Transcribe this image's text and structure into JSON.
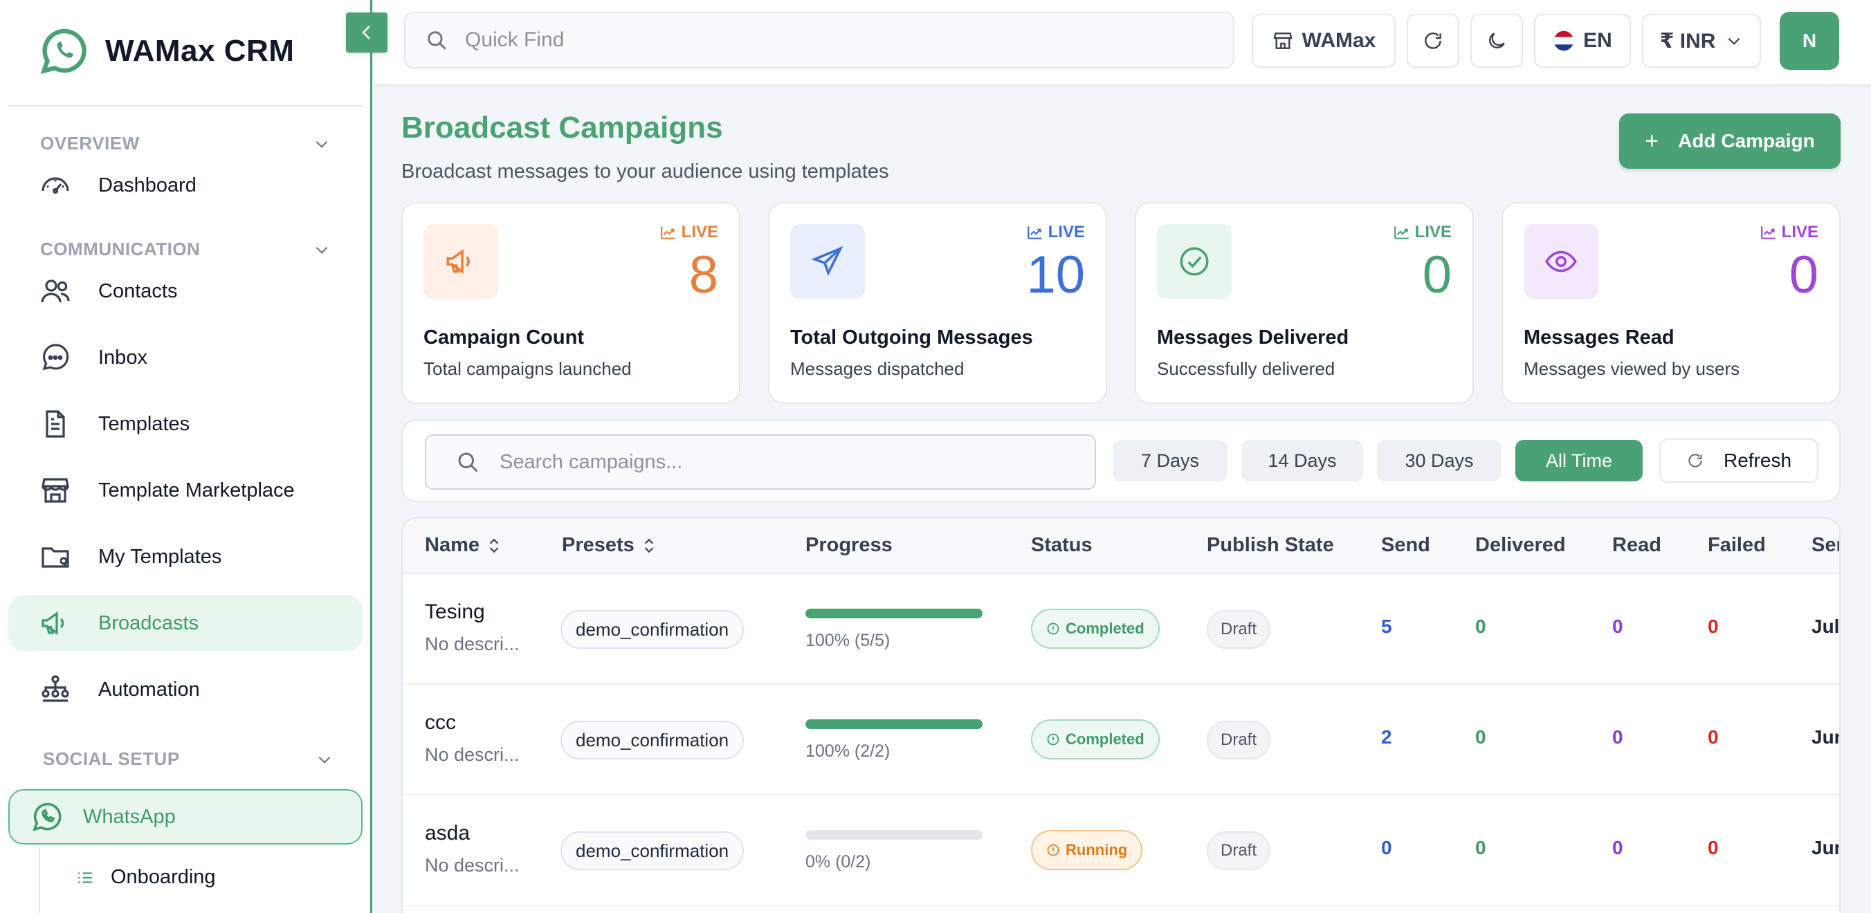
{
  "app": {
    "title": "WAMax CRM"
  },
  "sidebar": {
    "sections": {
      "overview": "OVERVIEW",
      "communication": "COMMUNICATION",
      "social": "SOCIAL SETUP"
    },
    "items": {
      "dashboard": "Dashboard",
      "contacts": "Contacts",
      "inbox": "Inbox",
      "templates": "Templates",
      "marketplace": "Template Marketplace",
      "my_templates": "My Templates",
      "broadcasts": "Broadcasts",
      "automation": "Automation",
      "whatsapp": "WhatsApp",
      "onboarding": "Onboarding"
    }
  },
  "topbar": {
    "search_placeholder": "Quick Find",
    "workspace": "WAMax",
    "language": "EN",
    "currency": "₹ INR",
    "avatar_initial": "N"
  },
  "page": {
    "title": "Broadcast Campaigns",
    "subtitle": "Broadcast messages to your audience using templates",
    "add_button": "Add Campaign"
  },
  "stats": [
    {
      "live": "LIVE",
      "value": "8",
      "label": "Campaign Count",
      "desc": "Total campaigns launched",
      "color": "#e8803a",
      "bg": "#fdf1e7"
    },
    {
      "live": "LIVE",
      "value": "10",
      "label": "Total Outgoing Messages",
      "desc": "Messages dispatched",
      "color": "#3d6fd8",
      "bg": "#e9effb"
    },
    {
      "live": "LIVE",
      "value": "0",
      "label": "Messages Delivered",
      "desc": "Successfully delivered",
      "color": "#4aa274",
      "bg": "#e8f6ee"
    },
    {
      "live": "LIVE",
      "value": "0",
      "label": "Messages Read",
      "desc": "Messages viewed by users",
      "color": "#a246db",
      "bg": "#f4e8fc"
    }
  ],
  "filters": {
    "search_placeholder": "Search campaigns...",
    "ranges": [
      "7 Days",
      "14 Days",
      "30 Days",
      "All Time"
    ],
    "active_range": "All Time",
    "refresh": "Refresh"
  },
  "table": {
    "headers": [
      "Name",
      "Presets",
      "Progress",
      "Status",
      "Publish State",
      "Send",
      "Delivered",
      "Read",
      "Failed",
      "Ser"
    ],
    "rows": [
      {
        "name": "Tesing",
        "desc": "No descri...",
        "preset": "demo_confirmation",
        "progress": 1.0,
        "progress_text": "100% (5/5)",
        "status": "Completed",
        "publish": "Draft",
        "send": "5",
        "delivered": "0",
        "read": "0",
        "failed": "0",
        "date": "Jul"
      },
      {
        "name": "ccc",
        "desc": "No descri...",
        "preset": "demo_confirmation",
        "progress": 1.0,
        "progress_text": "100% (2/2)",
        "status": "Completed",
        "publish": "Draft",
        "send": "2",
        "delivered": "0",
        "read": "0",
        "failed": "0",
        "date": "Jun"
      },
      {
        "name": "asda",
        "desc": "No descri...",
        "preset": "demo_confirmation",
        "progress": 0.0,
        "progress_text": "0% (0/2)",
        "status": "Running",
        "publish": "Draft",
        "send": "0",
        "delivered": "0",
        "read": "0",
        "failed": "0",
        "date": "Jun"
      }
    ]
  }
}
